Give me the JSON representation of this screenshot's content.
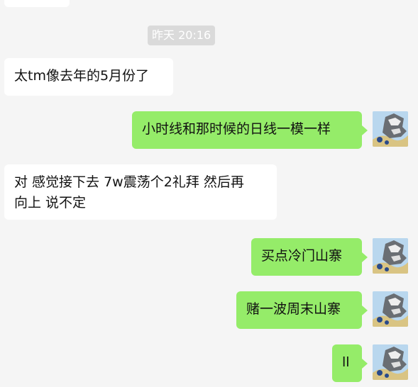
{
  "chat": {
    "timestamp": "昨天 20:16",
    "messages": [
      {
        "text": "太tm像去年的5月份了"
      },
      {
        "text": "小时线和那时候的日线一模一样"
      },
      {
        "line1": "对 感觉接下去 7w震荡个2礼拜 然后再",
        "line2": "向上 说不定"
      },
      {
        "text": "买点冷门山寨"
      },
      {
        "text": "赌一波周末山寨"
      },
      {
        "text": "ll"
      }
    ]
  },
  "colors": {
    "background": "#f5f5f5",
    "incoming_bubble": "#ffffff",
    "outgoing_bubble": "#95ec69",
    "timestamp_bg": "#dadada"
  }
}
